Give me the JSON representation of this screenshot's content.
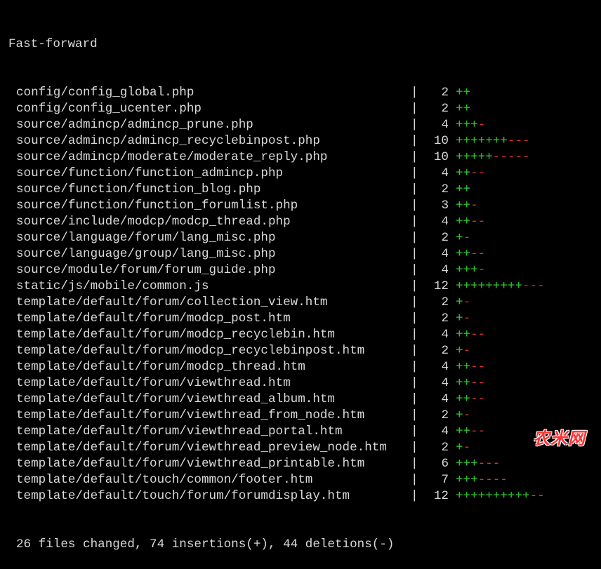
{
  "header": "Fast-forward",
  "separator": "|",
  "files": [
    {
      "path": "config/config_global.php",
      "count": "2",
      "plus": "++",
      "minus": ""
    },
    {
      "path": "config/config_ucenter.php",
      "count": "2",
      "plus": "++",
      "minus": ""
    },
    {
      "path": "source/admincp/admincp_prune.php",
      "count": "4",
      "plus": "+++",
      "minus": "-"
    },
    {
      "path": "source/admincp/admincp_recyclebinpost.php",
      "count": "10",
      "plus": "+++++++",
      "minus": "---"
    },
    {
      "path": "source/admincp/moderate/moderate_reply.php",
      "count": "10",
      "plus": "+++++",
      "minus": "-----"
    },
    {
      "path": "source/function/function_admincp.php",
      "count": "4",
      "plus": "++",
      "minus": "--"
    },
    {
      "path": "source/function/function_blog.php",
      "count": "2",
      "plus": "++",
      "minus": ""
    },
    {
      "path": "source/function/function_forumlist.php",
      "count": "3",
      "plus": "++",
      "minus": "-"
    },
    {
      "path": "source/include/modcp/modcp_thread.php",
      "count": "4",
      "plus": "++",
      "minus": "--"
    },
    {
      "path": "source/language/forum/lang_misc.php",
      "count": "2",
      "plus": "+",
      "minus": "-"
    },
    {
      "path": "source/language/group/lang_misc.php",
      "count": "4",
      "plus": "++",
      "minus": "--"
    },
    {
      "path": "source/module/forum/forum_guide.php",
      "count": "4",
      "plus": "+++",
      "minus": "-"
    },
    {
      "path": "static/js/mobile/common.js",
      "count": "12",
      "plus": "+++++++++",
      "minus": "---"
    },
    {
      "path": "template/default/forum/collection_view.htm",
      "count": "2",
      "plus": "+",
      "minus": "-"
    },
    {
      "path": "template/default/forum/modcp_post.htm",
      "count": "2",
      "plus": "+",
      "minus": "-"
    },
    {
      "path": "template/default/forum/modcp_recyclebin.htm",
      "count": "4",
      "plus": "++",
      "minus": "--"
    },
    {
      "path": "template/default/forum/modcp_recyclebinpost.htm",
      "count": "2",
      "plus": "+",
      "minus": "-"
    },
    {
      "path": "template/default/forum/modcp_thread.htm",
      "count": "4",
      "plus": "++",
      "minus": "--"
    },
    {
      "path": "template/default/forum/viewthread.htm",
      "count": "4",
      "plus": "++",
      "minus": "--"
    },
    {
      "path": "template/default/forum/viewthread_album.htm",
      "count": "4",
      "plus": "++",
      "minus": "--"
    },
    {
      "path": "template/default/forum/viewthread_from_node.htm",
      "count": "2",
      "plus": "+",
      "minus": "-"
    },
    {
      "path": "template/default/forum/viewthread_portal.htm",
      "count": "4",
      "plus": "++",
      "minus": "--"
    },
    {
      "path": "template/default/forum/viewthread_preview_node.htm",
      "count": "2",
      "plus": "+",
      "minus": "-"
    },
    {
      "path": "template/default/forum/viewthread_printable.htm",
      "count": "6",
      "plus": "+++",
      "minus": "---"
    },
    {
      "path": "template/default/touch/common/footer.htm",
      "count": "7",
      "plus": "+++",
      "minus": "----"
    },
    {
      "path": "template/default/touch/forum/forumdisplay.htm",
      "count": "12",
      "plus": "++++++++++",
      "minus": "--"
    }
  ],
  "summary": "26 files changed, 74 insertions(+), 44 deletions(-)",
  "watermark": "农米网",
  "colors": {
    "background": "#000000",
    "text": "#d9d9d9",
    "plus": "#2fcf2f",
    "minus": "#e03030",
    "watermark": "#ff3333"
  }
}
